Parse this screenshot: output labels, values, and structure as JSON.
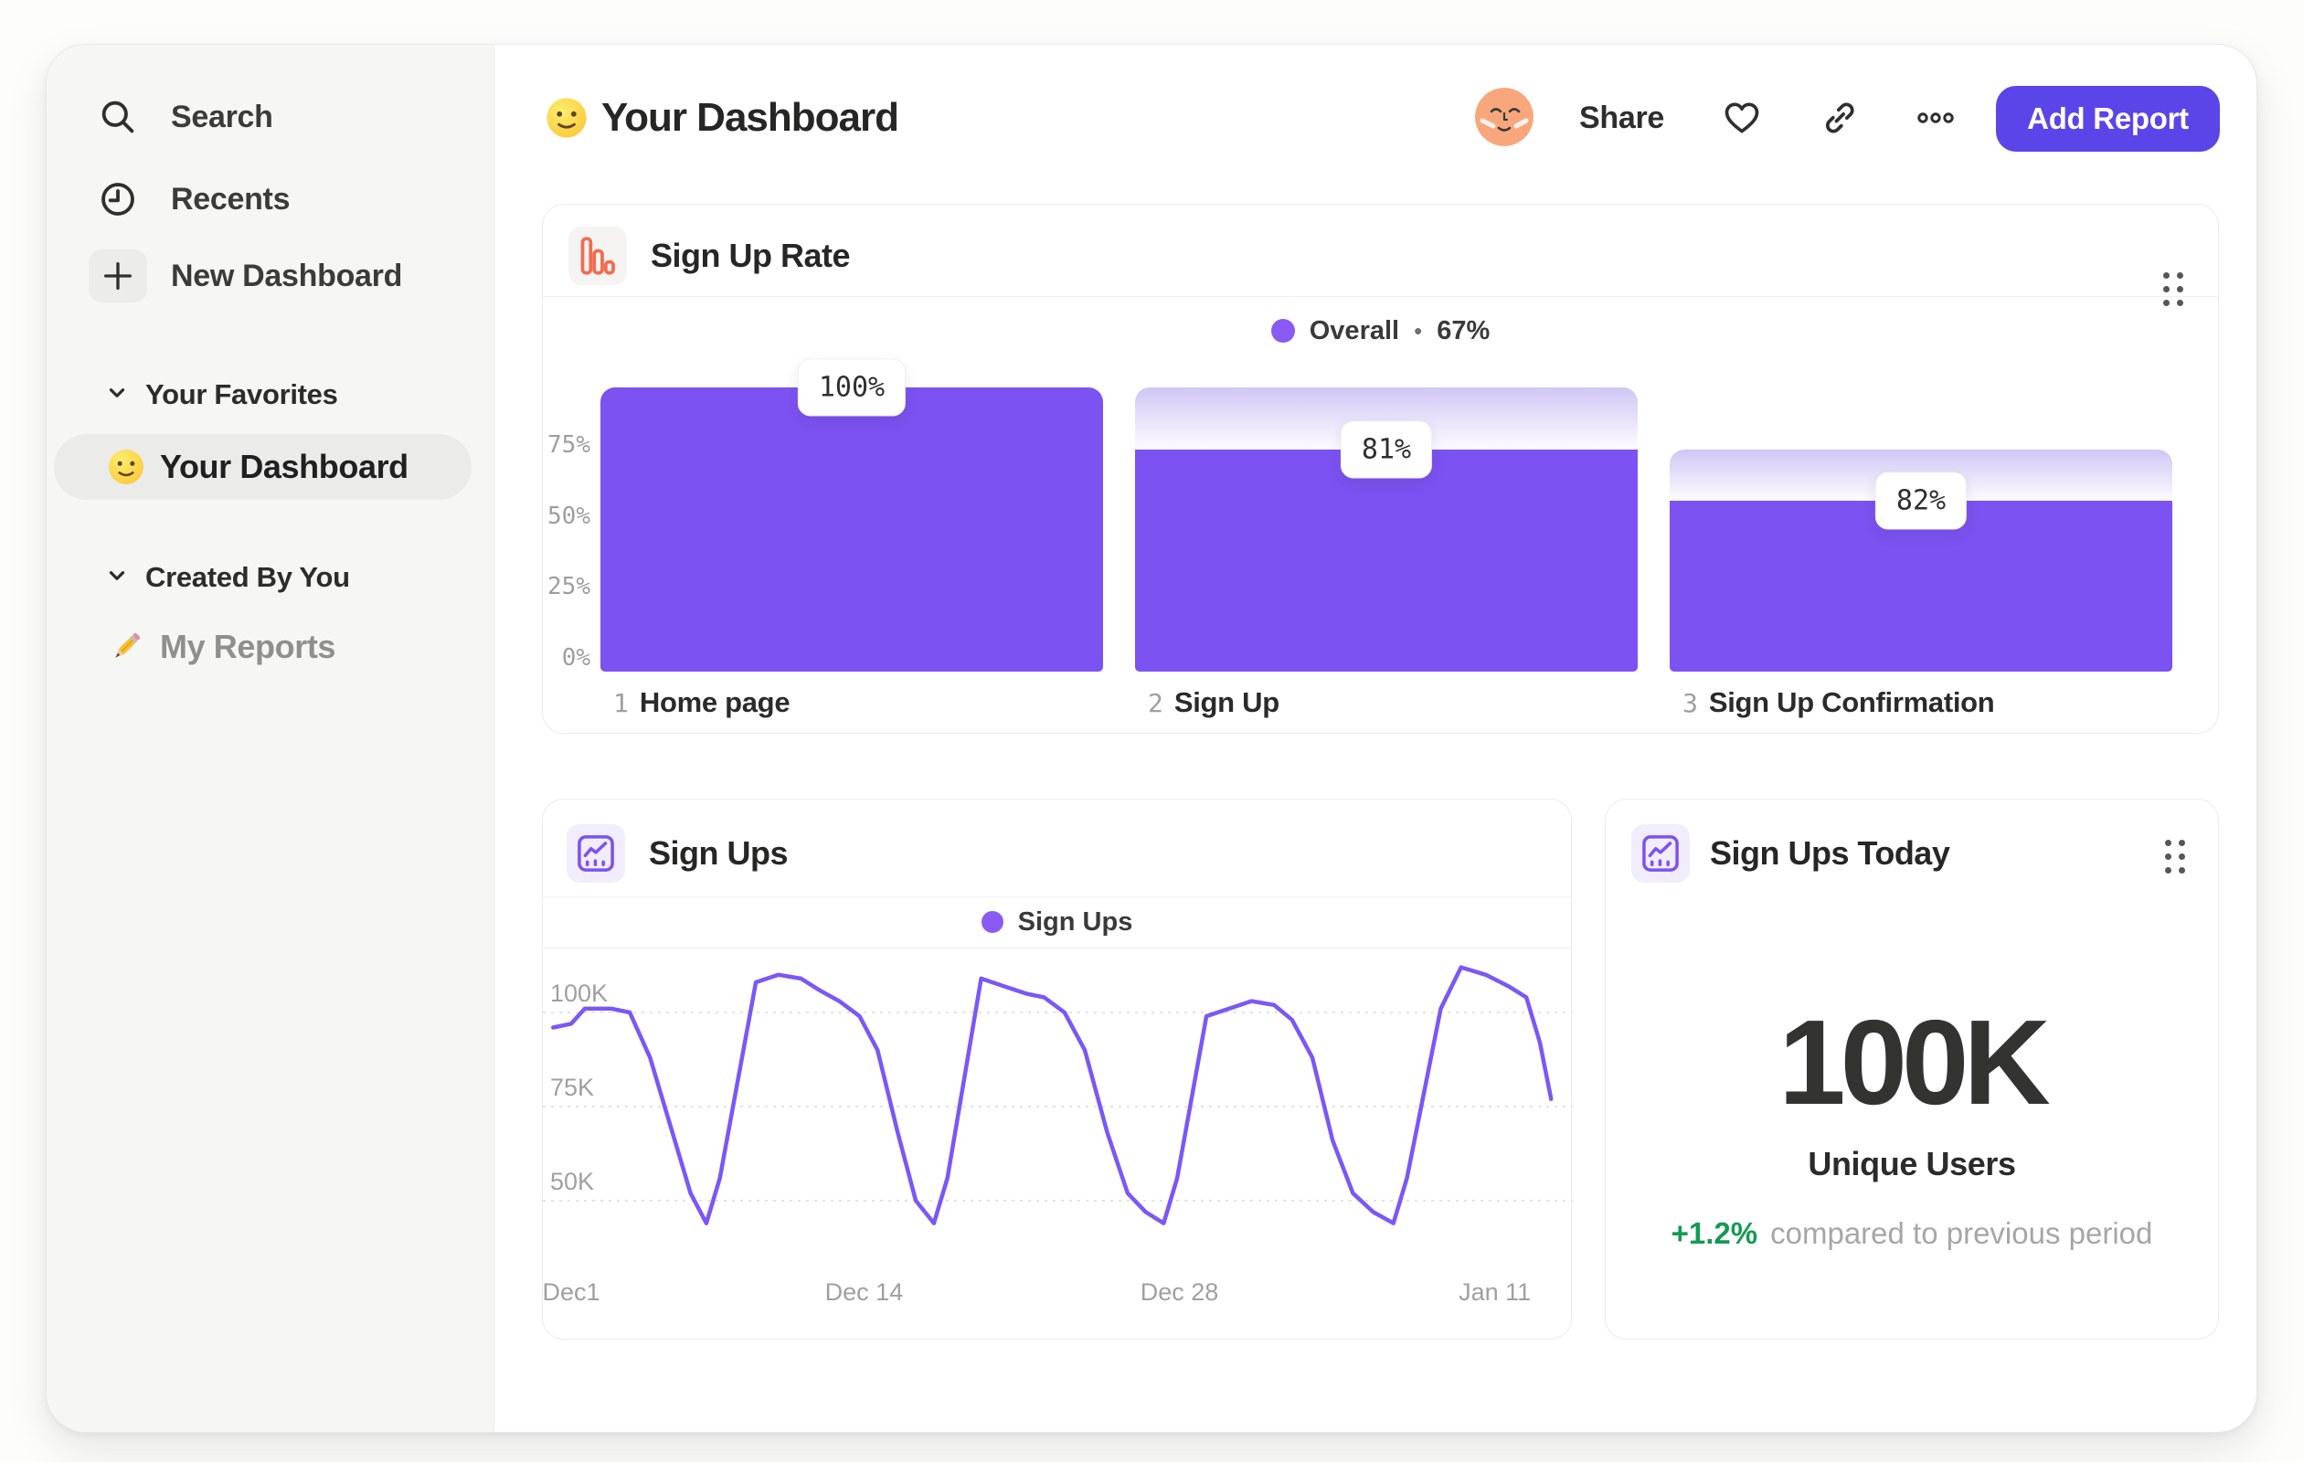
{
  "colors": {
    "accent_purple": "#7C52F1",
    "legend_purple": "#8A5AF5",
    "button_purple": "#5B45E9",
    "funnel_icon_orange": "#F26B50",
    "delta_green": "#149A52",
    "sidebar_bg": "#F6F6F4"
  },
  "sidebar": {
    "nav": [
      {
        "icon": "search-icon",
        "label": "Search"
      },
      {
        "icon": "clock-icon",
        "label": "Recents"
      },
      {
        "icon": "plus-icon",
        "label": "New Dashboard"
      }
    ],
    "favorites_title": "Your Favorites",
    "favorite_item": "Your Dashboard",
    "created_title": "Created By You",
    "created_item": "My Reports"
  },
  "header": {
    "title": "Your Dashboard",
    "share": "Share",
    "add_report": "Add Report"
  },
  "metric_card": {
    "title": "Sign Ups Today",
    "value": "100K",
    "label": "Unique Users",
    "delta": "+1.2%",
    "note": "compared to previous period"
  },
  "chart_data": [
    {
      "type": "bar",
      "variant": "funnel",
      "title": "Sign Up Rate",
      "legend": {
        "name": "Overall",
        "separator": "•",
        "value": "67%"
      },
      "yticks": [
        "0%",
        "25%",
        "50%",
        "75%"
      ],
      "ytick_values": [
        0,
        25,
        50,
        75
      ],
      "ylim": [
        0,
        100
      ],
      "grid": false,
      "steps": [
        {
          "num": "1",
          "name": "Home page",
          "conversion": "100%",
          "height_pct": 100,
          "prev_height_pct": 100
        },
        {
          "num": "2",
          "name": "Sign Up",
          "conversion": "81%",
          "height_pct": 78,
          "prev_height_pct": 100
        },
        {
          "num": "3",
          "name": "Sign Up Confirmation",
          "conversion": "82%",
          "height_pct": 60,
          "prev_height_pct": 78
        }
      ]
    },
    {
      "type": "line",
      "title": "Sign Ups",
      "legend": "Sign Ups",
      "grid": "dashed-horizontal",
      "yticks": [
        "100K",
        "75K",
        "50K"
      ],
      "ytick_values": [
        100,
        75,
        50
      ],
      "y_unit": "thousands of sign ups",
      "xticks": [
        "Dec1",
        "Dec 14",
        "Dec 28",
        "Jan 11"
      ],
      "xtick_days": [
        0,
        13,
        27,
        41
      ],
      "x_unit": "days from Dec 1",
      "points": [
        [
          -0.8,
          96
        ],
        [
          0,
          97
        ],
        [
          0.6,
          101
        ],
        [
          1.8,
          101
        ],
        [
          2.6,
          100
        ],
        [
          3.5,
          88
        ],
        [
          4.5,
          68
        ],
        [
          5.3,
          52
        ],
        [
          6.0,
          44
        ],
        [
          6.6,
          56
        ],
        [
          8.2,
          108
        ],
        [
          9.2,
          110
        ],
        [
          10.2,
          109
        ],
        [
          11.0,
          106
        ],
        [
          11.9,
          103
        ],
        [
          12.8,
          99
        ],
        [
          13.6,
          90
        ],
        [
          14.5,
          68
        ],
        [
          15.3,
          50
        ],
        [
          16.1,
          44
        ],
        [
          16.7,
          56
        ],
        [
          18.2,
          109
        ],
        [
          19.2,
          107
        ],
        [
          20.2,
          105
        ],
        [
          21.0,
          104
        ],
        [
          21.9,
          100
        ],
        [
          22.8,
          90
        ],
        [
          23.8,
          68
        ],
        [
          24.7,
          52
        ],
        [
          25.5,
          47
        ],
        [
          26.3,
          44
        ],
        [
          26.9,
          56
        ],
        [
          28.2,
          99
        ],
        [
          29.2,
          101
        ],
        [
          30.2,
          103
        ],
        [
          31.2,
          102
        ],
        [
          32.0,
          98
        ],
        [
          32.9,
          88
        ],
        [
          33.8,
          66
        ],
        [
          34.7,
          52
        ],
        [
          35.6,
          47
        ],
        [
          36.5,
          44
        ],
        [
          37.1,
          56
        ],
        [
          38.6,
          101
        ],
        [
          39.5,
          112
        ],
        [
          40.6,
          110
        ],
        [
          41.6,
          107
        ],
        [
          42.4,
          104
        ],
        [
          43.0,
          92
        ],
        [
          43.5,
          77
        ]
      ]
    }
  ]
}
